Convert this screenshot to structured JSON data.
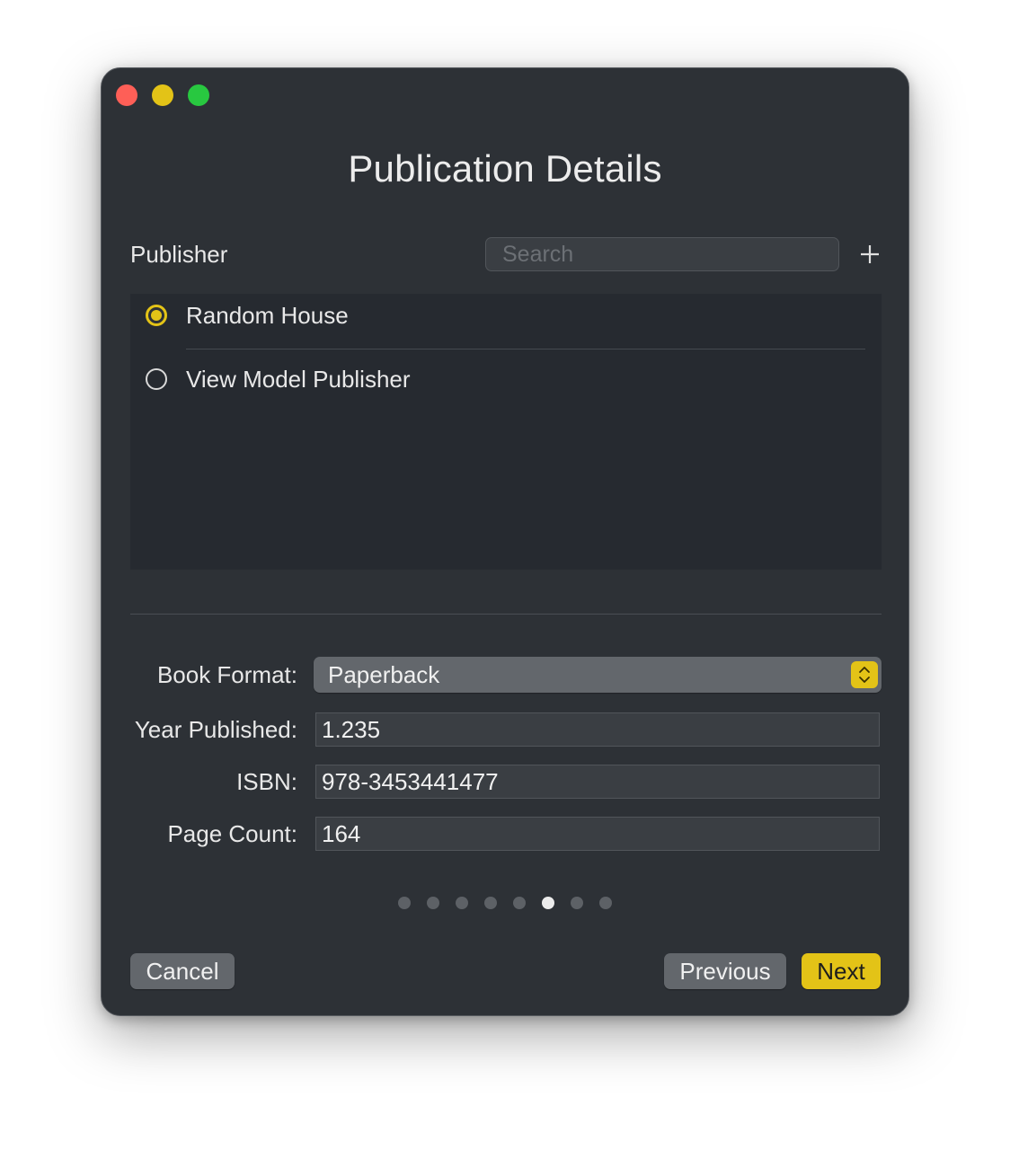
{
  "window": {
    "title": "Publication Details"
  },
  "publisher": {
    "label": "Publisher",
    "search_placeholder": "Search",
    "add_icon": "plus-icon",
    "items": [
      {
        "label": "Random House",
        "selected": true
      },
      {
        "label": "View Model Publisher",
        "selected": false
      }
    ]
  },
  "form": {
    "book_format": {
      "label": "Book Format:",
      "value": "Paperback"
    },
    "year_published": {
      "label": "Year Published:",
      "value": "1.235"
    },
    "isbn": {
      "label": "ISBN:",
      "value": "978-3453441477"
    },
    "page_count": {
      "label": "Page Count:",
      "value": "164"
    }
  },
  "pagination": {
    "total": 8,
    "current": 6
  },
  "buttons": {
    "cancel": "Cancel",
    "previous": "Previous",
    "next": "Next"
  },
  "colors": {
    "accent": "#e3c317",
    "window_bg": "#2d3136",
    "list_bg": "#262a30"
  }
}
